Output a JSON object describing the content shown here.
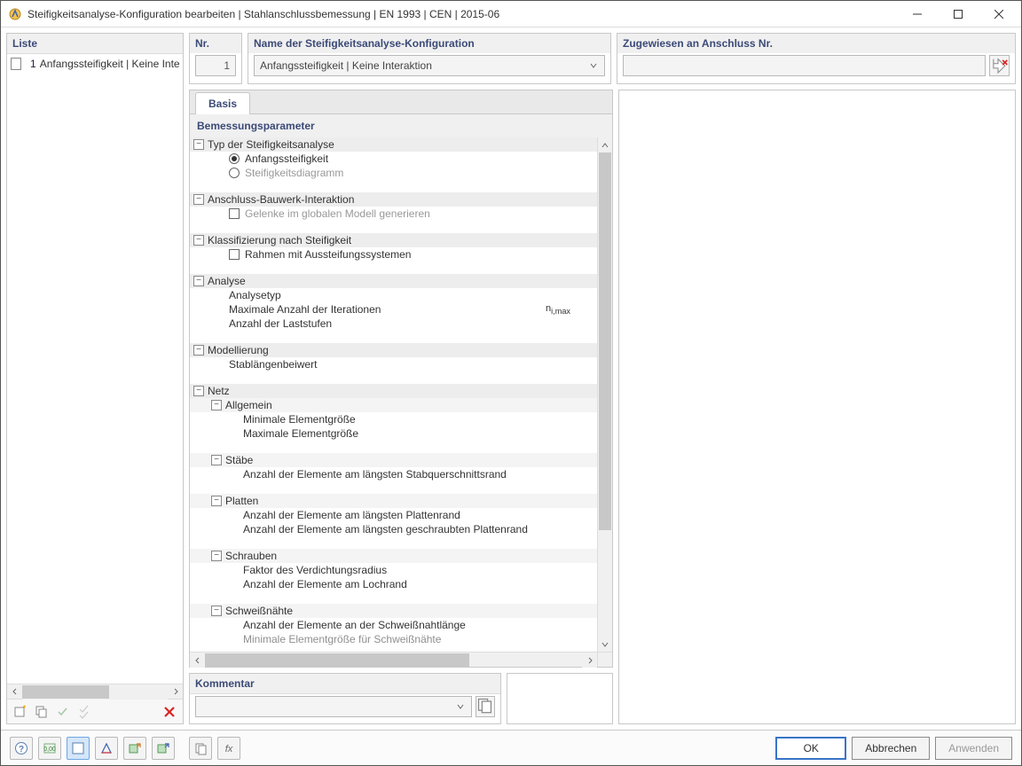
{
  "titlebar": {
    "title": "Steifigkeitsanalyse-Konfiguration bearbeiten | Stahlanschlussbemessung | EN 1993 | CEN | 2015-06"
  },
  "leftPane": {
    "header": "Liste",
    "items": [
      {
        "num": "1",
        "label": "Anfangssteifigkeit | Keine Interaktion"
      }
    ]
  },
  "nr": {
    "header": "Nr.",
    "value": "1"
  },
  "name": {
    "header": "Name der Steifigkeitsanalyse-Konfiguration",
    "value": "Anfangssteifigkeit | Keine Interaktion"
  },
  "assign": {
    "header": "Zugewiesen an Anschluss Nr.",
    "value": ""
  },
  "tabs": {
    "basis": "Basis"
  },
  "params": {
    "header": "Bemessungsparameter",
    "g_type": "Typ der Steifigkeitsanalyse",
    "r_initial": "Anfangssteifigkeit",
    "r_diagram": "Steifigkeitsdiagramm",
    "g_interaction": "Anschluss-Bauwerk-Interaktion",
    "c_hinges": "Gelenke im globalen Modell generieren",
    "g_class": "Klassifizierung nach Steifigkeit",
    "c_braced": "Rahmen mit Aussteifungssystemen",
    "g_analysis": "Analyse",
    "l_atype": "Analysetyp",
    "l_maxiter": "Maximale Anzahl der Iterationen",
    "l_maxiter_sym": "n",
    "l_maxiter_sub": "i,max",
    "l_loadsteps": "Anzahl der Laststufen",
    "g_model": "Modellierung",
    "l_memberlen": "Stablängenbeiwert",
    "g_mesh": "Netz",
    "sg_general": "Allgemein",
    "l_minelem": "Minimale Elementgröße",
    "l_maxelem": "Maximale Elementgröße",
    "sg_members": "Stäbe",
    "l_nelem_cs": "Anzahl der Elemente am längsten Stabquerschnittsrand",
    "sg_plates": "Platten",
    "l_nelem_plate": "Anzahl der Elemente am längsten Plattenrand",
    "l_nelem_bolted": "Anzahl der Elemente am längsten geschraubten Plattenrand",
    "sg_bolts": "Schrauben",
    "l_compfactor": "Faktor des Verdichtungsradius",
    "l_nelem_hole": "Anzahl der Elemente am Lochrand",
    "sg_welds": "Schweißnähte",
    "l_nelem_weld": "Anzahl der Elemente an der Schweißnahtlänge",
    "l_minelem_weld": "Minimale Elementgröße für Schweißnähte"
  },
  "kommentar": {
    "header": "Kommentar",
    "value": ""
  },
  "buttons": {
    "ok": "OK",
    "cancel": "Abbrechen",
    "apply": "Anwenden"
  }
}
